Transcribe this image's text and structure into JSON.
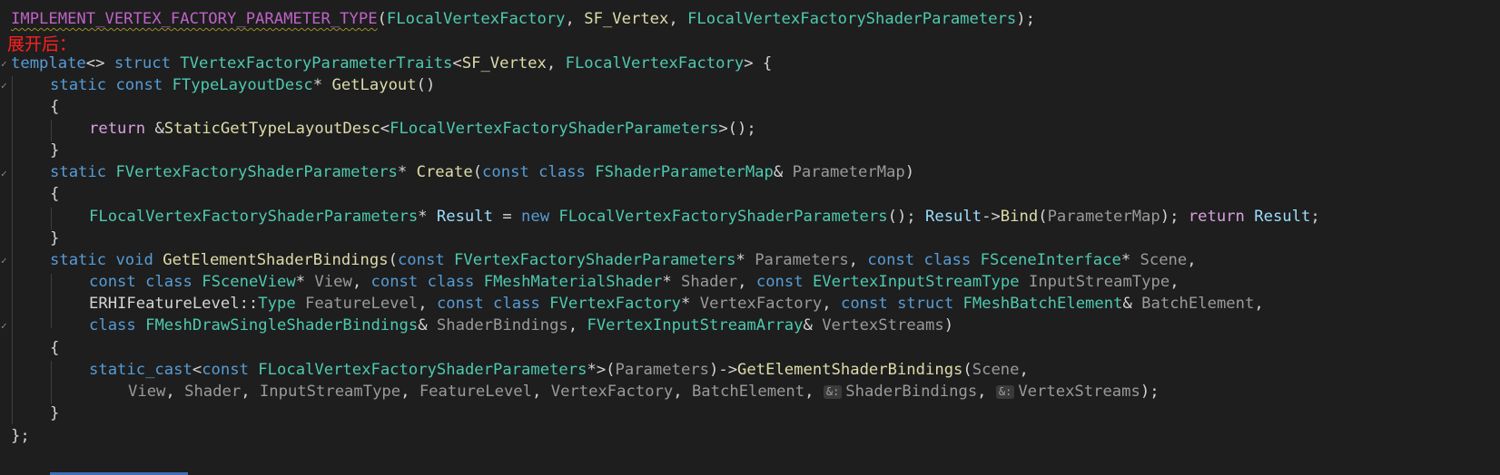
{
  "annotation": "展开后：",
  "inlay_hint": "&:",
  "colors": {
    "background": "#1e1e1e",
    "annotation": "#ff2020",
    "function": "#dcdcaa",
    "type": "#4ec9b0",
    "keyword": "#569cd6",
    "control": "#d8a0df",
    "parameter": "#9a9a9a",
    "variable": "#9cdcfe"
  },
  "code": {
    "l1": {
      "macro": "IMPLEMENT_VERTEX_FACTORY_PARAMETER_TYPE",
      "open": "(",
      "a1": "FLocalVertexFactory",
      "c1": ", ",
      "a2": "SF_Vertex",
      "c2": ", ",
      "a3": "FLocalVertexFactoryShaderParameters",
      "close": ");"
    },
    "l3": {
      "kw1": "template",
      "p1": "<> ",
      "kw2": "struct",
      "sp": " ",
      "t1": "TVertexFactoryParameterTraits",
      "p2": "<",
      "a1": "SF_Vertex",
      "c1": ", ",
      "t2": "FLocalVertexFactory",
      "p3": "> {"
    },
    "l4": {
      "kw1": "static",
      "sp1": " ",
      "kw2": "const",
      "sp2": " ",
      "t1": "FTypeLayoutDesc",
      "p1": "* ",
      "f1": "GetLayout",
      "p2": "()"
    },
    "l5": {
      "p1": "{"
    },
    "l6": {
      "kw1": "return",
      "p1": " &",
      "f1": "StaticGetTypeLayoutDesc",
      "p2": "<",
      "t1": "FLocalVertexFactoryShaderParameters",
      "p3": ">();"
    },
    "l7": {
      "p1": "}"
    },
    "l8": {
      "kw1": "static",
      "sp1": " ",
      "t1": "FVertexFactoryShaderParameters",
      "p1": "* ",
      "f1": "Create",
      "p2": "(",
      "kw2": "const",
      "sp2": " ",
      "kw3": "class",
      "sp3": " ",
      "t2": "FShaderParameterMap",
      "p3": "& ",
      "pa1": "ParameterMap",
      "p4": ")"
    },
    "l9": {
      "p1": "{"
    },
    "l10": {
      "t1": "FLocalVertexFactoryShaderParameters",
      "p1": "* ",
      "v1": "Result",
      "p2": " = ",
      "kw1": "new",
      "sp1": " ",
      "t2": "FLocalVertexFactoryShaderParameters",
      "p3": "(); ",
      "v2": "Result",
      "p4": "->",
      "f1": "Bind",
      "p5": "(",
      "pa1": "ParameterMap",
      "p6": "); ",
      "kw2": "return",
      "sp2": " ",
      "v3": "Result",
      "p7": ";"
    },
    "l11": {
      "p1": "}"
    },
    "l12": {
      "kw1": "static",
      "sp1": " ",
      "kw2": "void",
      "sp2": " ",
      "f1": "GetElementShaderBindings",
      "p1": "(",
      "kw3": "const",
      "sp3": " ",
      "t1": "FVertexFactoryShaderParameters",
      "p2": "* ",
      "pa1": "Parameters",
      "p3": ", ",
      "kw4": "const",
      "sp4": " ",
      "kw5": "class",
      "sp5": " ",
      "t2": "FSceneInterface",
      "p4": "* ",
      "pa2": "Scene",
      "p5": ","
    },
    "l13": {
      "kw1": "const",
      "sp1": " ",
      "kw2": "class",
      "sp2": " ",
      "t1": "FSceneView",
      "p1": "* ",
      "pa1": "View",
      "p2": ", ",
      "kw3": "const",
      "sp3": " ",
      "kw4": "class",
      "sp4": " ",
      "t2": "FMeshMaterialShader",
      "p3": "* ",
      "pa2": "Shader",
      "p4": ", ",
      "kw5": "const",
      "sp5": " ",
      "t3": "EVertexInputStreamType",
      "sp6": " ",
      "pa3": "InputStreamType",
      "p5": ","
    },
    "l14": {
      "n1": "ERHIFeatureLevel",
      "p1": "::",
      "t1": "Type",
      "sp1": " ",
      "pa1": "FeatureLevel",
      "p2": ", ",
      "kw1": "const",
      "sp2": " ",
      "kw2": "class",
      "sp3": " ",
      "t2": "FVertexFactory",
      "p3": "* ",
      "pa2": "VertexFactory",
      "p4": ", ",
      "kw3": "const",
      "sp4": " ",
      "kw4": "struct",
      "sp5": " ",
      "t3": "FMeshBatchElement",
      "p5": "& ",
      "pa3": "BatchElement",
      "p6": ","
    },
    "l15": {
      "kw1": "class",
      "sp1": " ",
      "t1": "FMeshDrawSingleShaderBindings",
      "p1": "& ",
      "pa1": "ShaderBindings",
      "p2": ", ",
      "t2": "FVertexInputStreamArray",
      "p3": "& ",
      "pa2": "VertexStreams",
      "p4": ")"
    },
    "l16": {
      "p1": "{"
    },
    "l17": {
      "kw1": "static_cast",
      "p1": "<",
      "kw2": "const",
      "sp1": " ",
      "t1": "FLocalVertexFactoryShaderParameters",
      "p2": "*>(",
      "pa1": "Parameters",
      "p3": ")->",
      "f1": "GetElementShaderBindings",
      "p4": "(",
      "pa2": "Scene",
      "p5": ","
    },
    "l18": {
      "pa1": "View",
      "p1": ", ",
      "pa2": "Shader",
      "p2": ", ",
      "pa3": "InputStreamType",
      "p3": ", ",
      "pa4": "FeatureLevel",
      "p4": ", ",
      "pa5": "VertexFactory",
      "p5": ", ",
      "pa6": "BatchElement",
      "p6": ", ",
      "pa7": "ShaderBindings",
      "p7": ", ",
      "pa8": "VertexStreams",
      "p8": ");"
    },
    "l19": {
      "p1": "}"
    },
    "l20": {
      "p1": "};"
    }
  }
}
